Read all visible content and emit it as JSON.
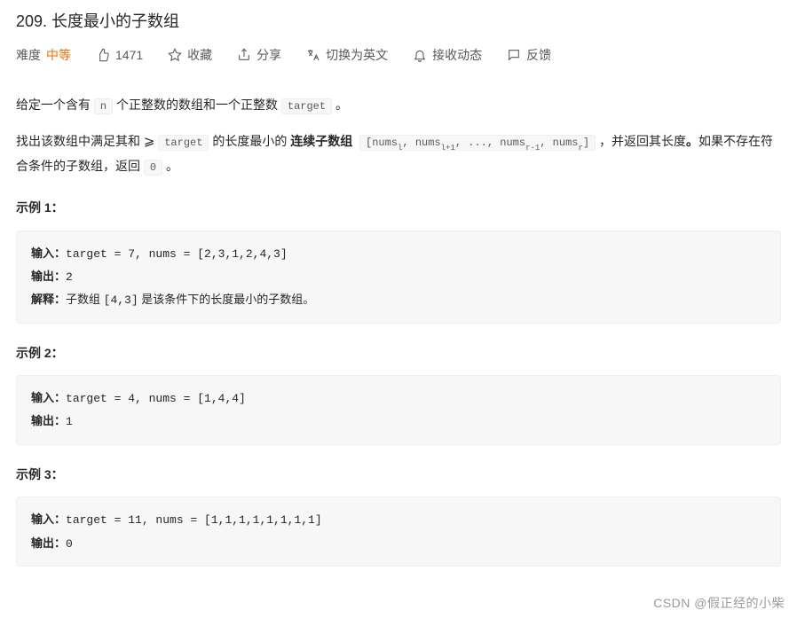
{
  "title": "209. 长度最小的子数组",
  "meta": {
    "difficulty_label": "难度",
    "difficulty_value": "中等",
    "likes": "1471",
    "favorite": "收藏",
    "share": "分享",
    "switch_lang": "切换为英文",
    "subscribe": "接收动态",
    "feedback": "反馈"
  },
  "desc": {
    "p1_a": "给定一个含有 ",
    "p1_n": "n",
    "p1_b": " 个正整数的数组和一个正整数 ",
    "p1_target": "target",
    "p1_c": " 。",
    "p2_a": "找出该数组中满足其和 ",
    "p2_ge": "≥",
    "p2_target": "target",
    "p2_b": " 的长度最小的 ",
    "p2_bold": "连续子数组",
    "p2_bracket": "[numsl, numsl+1, ..., numsr-1, numsr]",
    "p2_c": " ，并返回其长度",
    "p2_bold2": "。",
    "p2_d": "如果不存在符合条件的子数组，返回 ",
    "p2_zero": "0",
    "p2_e": " 。"
  },
  "examples": [
    {
      "title": "示例 1：",
      "input_label": "输入：",
      "input_value": "target = 7, nums = [2,3,1,2,4,3]",
      "output_label": "输出：",
      "output_value": "2",
      "explain_label": "解释：",
      "explain_a": "子数组 ",
      "explain_code": "[4,3]",
      "explain_b": " 是该条件下的长度最小的子数组。"
    },
    {
      "title": "示例 2：",
      "input_label": "输入：",
      "input_value": "target = 4, nums = [1,4,4]",
      "output_label": "输出：",
      "output_value": "1"
    },
    {
      "title": "示例 3：",
      "input_label": "输入：",
      "input_value": "target = 11, nums = [1,1,1,1,1,1,1,1]",
      "output_label": "输出：",
      "output_value": "0"
    }
  ],
  "watermark": "CSDN @假正经的小柴"
}
